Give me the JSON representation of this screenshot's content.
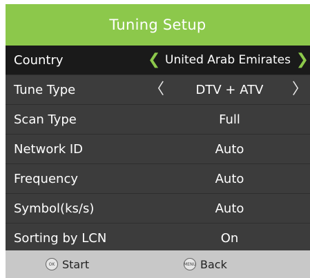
{
  "header": {
    "title": "Tuning Setup"
  },
  "menu": {
    "rows": [
      {
        "label": "Country",
        "value": "United Arab Emirates"
      },
      {
        "label": "Tune Type",
        "value": "DTV + ATV"
      },
      {
        "label": "Scan Type",
        "value": "Full"
      },
      {
        "label": "Network ID",
        "value": "Auto"
      },
      {
        "label": "Frequency",
        "value": "Auto"
      },
      {
        "label": "Symbol(ks/s)",
        "value": "Auto"
      },
      {
        "label": "Sorting by LCN",
        "value": "On"
      }
    ]
  },
  "footer": {
    "start_key": "OK",
    "start_label": "Start",
    "back_key": "MENU",
    "back_label": "Back"
  },
  "colors": {
    "accent": "#8cc84b",
    "panel": "#3a3a3a",
    "selected_row": "#1a1a1a",
    "footer": "#c8c8c8"
  },
  "icons": {
    "left": "chevron-left-icon",
    "right": "chevron-right-icon"
  }
}
